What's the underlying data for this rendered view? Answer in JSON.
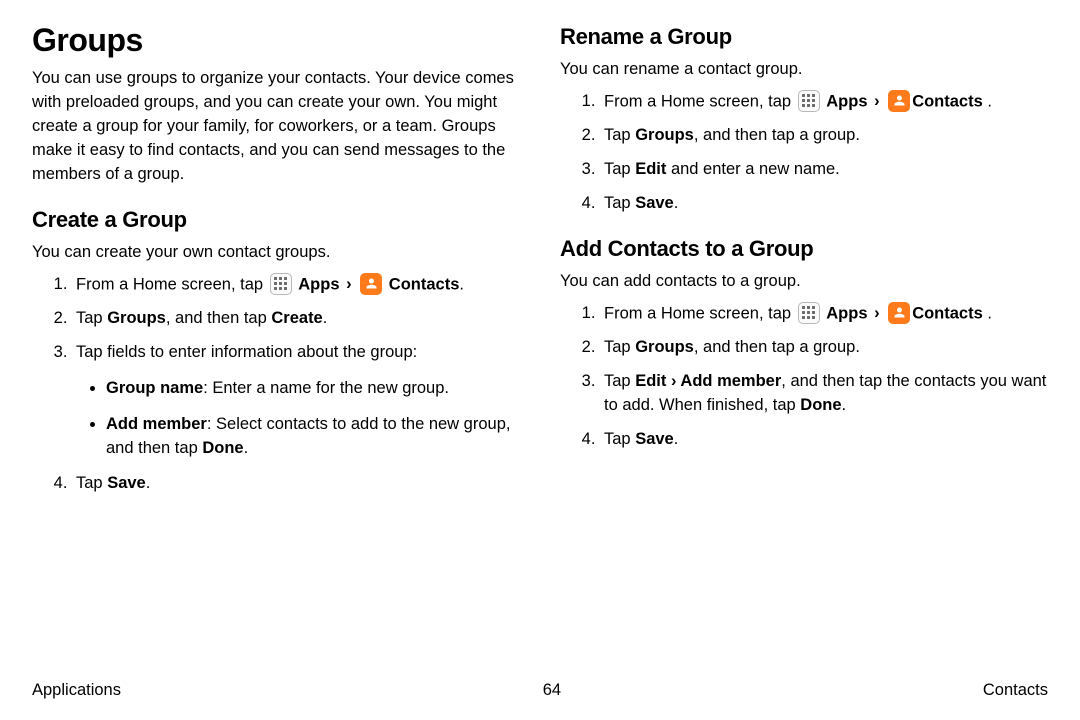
{
  "left": {
    "h1": "Groups",
    "intro": "You can use groups to organize your contacts. Your device comes with preloaded groups, and you can create your own. You might create a group for your family, for coworkers, or a team. Groups make it easy to find contacts, and you can send messages to the members of a group.",
    "create": {
      "h2": "Create a Group",
      "desc": "You can create your own contact groups.",
      "s1_a": "From a Home screen, tap ",
      "apps": "Apps",
      "gt": "›",
      "contacts": "Contacts",
      "period": ".",
      "s2_a": "Tap ",
      "s2_b": "Groups",
      "s2_c": ", and then tap ",
      "s2_d": "Create",
      "s3": "Tap fields to enter information about the group:",
      "b1_a": "Group name",
      "b1_b": ": Enter a name for the new group.",
      "b2_a": "Add member",
      "b2_b": ": Select contacts to add to the new group, and then tap ",
      "b2_c": "Done",
      "s4_a": "Tap ",
      "s4_b": "Save"
    }
  },
  "right": {
    "rename": {
      "h2": "Rename a Group",
      "desc": "You can rename a contact group.",
      "s1_a": "From a Home screen, tap ",
      "apps": "Apps",
      "gt": "›",
      "contacts": "Contacts",
      "space_period": " .",
      "s2_a": "Tap ",
      "s2_b": "Groups",
      "s2_c": ", and then tap a group.",
      "s3_a": "Tap ",
      "s3_b": "Edit",
      "s3_c": " and enter a new name.",
      "s4_a": "Tap ",
      "s4_b": "Save",
      "period": "."
    },
    "add": {
      "h2": "Add Contacts to a Group",
      "desc": "You can add contacts to a group.",
      "s1_a": "From a Home screen, tap ",
      "apps": "Apps",
      "gt": "›",
      "contacts": "Contacts",
      "space_period": " .",
      "s2_a": "Tap ",
      "s2_b": "Groups",
      "s2_c": ", and then tap a group.",
      "s3_a": "Tap ",
      "s3_b": "Edit",
      "s3_gt": " › ",
      "s3_c": "Add member",
      "s3_d": ", and then tap the contacts you want to add. When finished, tap ",
      "s3_e": "Done",
      "period": ".",
      "s4_a": "Tap ",
      "s4_b": "Save"
    }
  },
  "footer": {
    "left": "Applications",
    "center": "64",
    "right": "Contacts"
  }
}
